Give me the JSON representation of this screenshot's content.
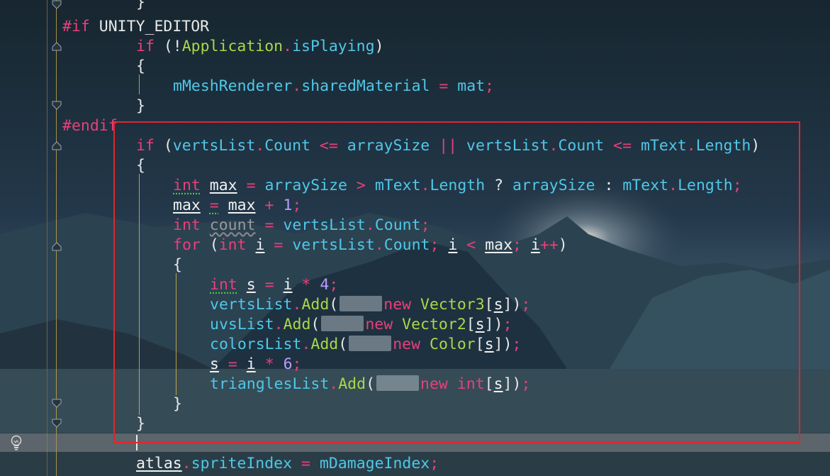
{
  "colors": {
    "keyword": "#e8407a",
    "field": "#4fc8e8",
    "type": "#a8d84a",
    "number": "#b89cff",
    "highlight_box": "#e0262e",
    "indent_guide": "#d7b24a"
  },
  "lines": [
    {
      "tokens": [
        {
          "t": "pun",
          "v": "}"
        }
      ]
    },
    {
      "tokens": [
        {
          "t": "pp",
          "v": "#if"
        },
        {
          "t": "pl",
          "v": " UNITY_EDITOR"
        }
      ]
    },
    {
      "tokens": [
        {
          "t": "kw",
          "v": "if"
        },
        {
          "t": "pun",
          "v": " (!"
        },
        {
          "t": "typ",
          "v": "Application"
        },
        {
          "t": "op",
          "v": "."
        },
        {
          "t": "fld",
          "v": "isPlaying"
        },
        {
          "t": "pun",
          "v": ")"
        }
      ]
    },
    {
      "tokens": [
        {
          "t": "pun",
          "v": "{"
        }
      ]
    },
    {
      "tokens": [
        {
          "t": "fld",
          "v": "mMeshRenderer"
        },
        {
          "t": "op",
          "v": "."
        },
        {
          "t": "fld",
          "v": "sharedMaterial"
        },
        {
          "t": "op",
          "v": " = "
        },
        {
          "t": "fld",
          "v": "mat"
        },
        {
          "t": "op",
          "v": ";"
        }
      ]
    },
    {
      "tokens": [
        {
          "t": "pun",
          "v": "}"
        }
      ]
    },
    {
      "tokens": [
        {
          "t": "pp",
          "v": "#endif"
        }
      ]
    },
    {
      "tokens": [
        {
          "t": "kw",
          "v": "if"
        },
        {
          "t": "pun",
          "v": " ("
        },
        {
          "t": "fld",
          "v": "vertsList"
        },
        {
          "t": "op",
          "v": "."
        },
        {
          "t": "fld",
          "v": "Count"
        },
        {
          "t": "op",
          "v": " <= "
        },
        {
          "t": "fld",
          "v": "arraySize"
        },
        {
          "t": "op",
          "v": " || "
        },
        {
          "t": "fld",
          "v": "vertsList"
        },
        {
          "t": "op",
          "v": "."
        },
        {
          "t": "fld",
          "v": "Count"
        },
        {
          "t": "op",
          "v": " <= "
        },
        {
          "t": "fld",
          "v": "mText"
        },
        {
          "t": "op",
          "v": "."
        },
        {
          "t": "fld",
          "v": "Length"
        },
        {
          "t": "pun",
          "v": ")"
        }
      ]
    },
    {
      "tokens": [
        {
          "t": "pun",
          "v": "{"
        }
      ]
    },
    {
      "tokens": [
        {
          "t": "kw hintdot",
          "v": "int"
        },
        {
          "t": "pl",
          "v": " "
        },
        {
          "t": "loc",
          "v": "max"
        },
        {
          "t": "op",
          "v": " = "
        },
        {
          "t": "fld",
          "v": "arraySize"
        },
        {
          "t": "op",
          "v": " > "
        },
        {
          "t": "fld",
          "v": "mText"
        },
        {
          "t": "op",
          "v": "."
        },
        {
          "t": "fld",
          "v": "Length"
        },
        {
          "t": "pun",
          "v": " ? "
        },
        {
          "t": "fld",
          "v": "arraySize"
        },
        {
          "t": "pun",
          "v": " : "
        },
        {
          "t": "fld",
          "v": "mText"
        },
        {
          "t": "op",
          "v": "."
        },
        {
          "t": "fld",
          "v": "Length"
        },
        {
          "t": "op",
          "v": ";"
        }
      ]
    },
    {
      "tokens": [
        {
          "t": "loc",
          "v": "max"
        },
        {
          "t": "op",
          "v": " "
        },
        {
          "t": "op hintdot",
          "v": "="
        },
        {
          "t": "pl",
          "v": " "
        },
        {
          "t": "loc",
          "v": "max"
        },
        {
          "t": "op",
          "v": " + "
        },
        {
          "t": "num",
          "v": "1"
        },
        {
          "t": "op",
          "v": ";"
        }
      ]
    },
    {
      "tokens": [
        {
          "t": "kw",
          "v": "int"
        },
        {
          "t": "pl",
          "v": " "
        },
        {
          "t": "unused",
          "v": "count"
        },
        {
          "t": "op",
          "v": " = "
        },
        {
          "t": "fld",
          "v": "vertsList"
        },
        {
          "t": "op",
          "v": "."
        },
        {
          "t": "fld",
          "v": "Count"
        },
        {
          "t": "op",
          "v": ";"
        }
      ]
    },
    {
      "tokens": [
        {
          "t": "kw",
          "v": "for"
        },
        {
          "t": "pun",
          "v": " ("
        },
        {
          "t": "kw",
          "v": "int"
        },
        {
          "t": "pl",
          "v": " "
        },
        {
          "t": "loc",
          "v": "i"
        },
        {
          "t": "op",
          "v": " = "
        },
        {
          "t": "fld",
          "v": "vertsList"
        },
        {
          "t": "op",
          "v": "."
        },
        {
          "t": "fld",
          "v": "Count"
        },
        {
          "t": "op",
          "v": "; "
        },
        {
          "t": "loc",
          "v": "i"
        },
        {
          "t": "op",
          "v": " < "
        },
        {
          "t": "loc",
          "v": "max"
        },
        {
          "t": "op",
          "v": "; "
        },
        {
          "t": "loc",
          "v": "i"
        },
        {
          "t": "op",
          "v": "++"
        },
        {
          "t": "pun",
          "v": ")"
        }
      ]
    },
    {
      "tokens": [
        {
          "t": "pun",
          "v": "{"
        }
      ]
    },
    {
      "tokens": [
        {
          "t": "kw hintdot",
          "v": "int"
        },
        {
          "t": "pl",
          "v": " "
        },
        {
          "t": "loc",
          "v": "s"
        },
        {
          "t": "op",
          "v": " = "
        },
        {
          "t": "loc",
          "v": "i"
        },
        {
          "t": "op",
          "v": " * "
        },
        {
          "t": "num",
          "v": "4"
        },
        {
          "t": "op",
          "v": ";"
        }
      ]
    },
    {
      "tokens": [
        {
          "t": "fld",
          "v": "vertsList"
        },
        {
          "t": "op",
          "v": "."
        },
        {
          "t": "typ",
          "v": "Add"
        },
        {
          "t": "pun",
          "v": "("
        },
        {
          "t": "blur",
          "v": ""
        },
        {
          "t": "kw",
          "v": "new"
        },
        {
          "t": "pl",
          "v": " "
        },
        {
          "t": "typ",
          "v": "Vector3"
        },
        {
          "t": "pun",
          "v": "["
        },
        {
          "t": "loc",
          "v": "s"
        },
        {
          "t": "pun",
          "v": "])"
        },
        {
          "t": "op",
          "v": ";"
        }
      ]
    },
    {
      "tokens": [
        {
          "t": "fld",
          "v": "uvsList"
        },
        {
          "t": "op",
          "v": "."
        },
        {
          "t": "typ",
          "v": "Add"
        },
        {
          "t": "pun",
          "v": "("
        },
        {
          "t": "blur",
          "v": ""
        },
        {
          "t": "kw",
          "v": "new"
        },
        {
          "t": "pl",
          "v": " "
        },
        {
          "t": "typ",
          "v": "Vector2"
        },
        {
          "t": "pun",
          "v": "["
        },
        {
          "t": "loc",
          "v": "s"
        },
        {
          "t": "pun",
          "v": "])"
        },
        {
          "t": "op",
          "v": ";"
        }
      ]
    },
    {
      "tokens": [
        {
          "t": "fld",
          "v": "colorsList"
        },
        {
          "t": "op",
          "v": "."
        },
        {
          "t": "typ",
          "v": "Add"
        },
        {
          "t": "pun",
          "v": "("
        },
        {
          "t": "blur",
          "v": ""
        },
        {
          "t": "kw",
          "v": "new"
        },
        {
          "t": "pl",
          "v": " "
        },
        {
          "t": "typ",
          "v": "Color"
        },
        {
          "t": "pun",
          "v": "["
        },
        {
          "t": "loc",
          "v": "s"
        },
        {
          "t": "pun",
          "v": "])"
        },
        {
          "t": "op",
          "v": ";"
        }
      ]
    },
    {
      "tokens": [
        {
          "t": "loc",
          "v": "s"
        },
        {
          "t": "op",
          "v": " = "
        },
        {
          "t": "loc",
          "v": "i"
        },
        {
          "t": "op",
          "v": " * "
        },
        {
          "t": "num",
          "v": "6"
        },
        {
          "t": "op",
          "v": ";"
        }
      ]
    },
    {
      "tokens": [
        {
          "t": "fld",
          "v": "trianglesList"
        },
        {
          "t": "op",
          "v": "."
        },
        {
          "t": "typ",
          "v": "Add"
        },
        {
          "t": "pun",
          "v": "("
        },
        {
          "t": "blur",
          "v": ""
        },
        {
          "t": "kw",
          "v": "new"
        },
        {
          "t": "pl",
          "v": " "
        },
        {
          "t": "kw",
          "v": "int"
        },
        {
          "t": "pun",
          "v": "["
        },
        {
          "t": "loc",
          "v": "s"
        },
        {
          "t": "pun",
          "v": "])"
        },
        {
          "t": "op",
          "v": ";"
        }
      ]
    },
    {
      "tokens": [
        {
          "t": "pun",
          "v": "}"
        }
      ]
    },
    {
      "tokens": [
        {
          "t": "pun",
          "v": "}"
        }
      ]
    },
    {
      "tokens": []
    },
    {
      "tokens": [
        {
          "t": "loc",
          "v": "atlas"
        },
        {
          "t": "op",
          "v": "."
        },
        {
          "t": "fld",
          "v": "spriteIndex"
        },
        {
          "t": "op",
          "v": " = "
        },
        {
          "t": "fld",
          "v": "mDamageIndex"
        },
        {
          "t": "op",
          "v": ";"
        }
      ]
    }
  ]
}
